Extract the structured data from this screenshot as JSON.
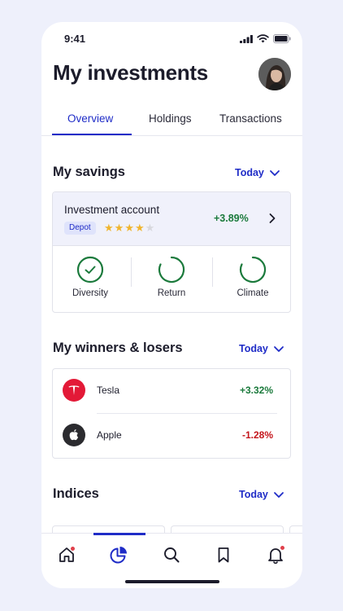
{
  "status_bar": {
    "time": "9:41"
  },
  "header": {
    "title": "My investments"
  },
  "tabs": [
    {
      "label": "Overview",
      "active": true
    },
    {
      "label": "Holdings",
      "active": false
    },
    {
      "label": "Transactions",
      "active": false
    }
  ],
  "savings": {
    "title": "My savings",
    "period": "Today",
    "account": {
      "name": "Investment account",
      "badge": "Depot",
      "rating": 4,
      "rating_max": 5,
      "change": "+3.89%"
    },
    "metrics": [
      {
        "label": "Diversity",
        "state": "check"
      },
      {
        "label": "Return",
        "state": "ring"
      },
      {
        "label": "Climate",
        "state": "ring"
      }
    ]
  },
  "winners_losers": {
    "title": "My winners & losers",
    "period": "Today",
    "items": [
      {
        "name": "Tesla",
        "change": "+3.32%",
        "direction": "up",
        "icon": "tesla-logo-icon"
      },
      {
        "name": "Apple",
        "change": "-1.28%",
        "direction": "down",
        "icon": "apple-logo-icon"
      }
    ]
  },
  "indices": {
    "title": "Indices",
    "period": "Today"
  },
  "bottom_nav": [
    {
      "icon": "home-icon",
      "active": false,
      "notification": true
    },
    {
      "icon": "portfolio-pie-icon",
      "active": true,
      "notification": false
    },
    {
      "icon": "search-icon",
      "active": false,
      "notification": false
    },
    {
      "icon": "bookmark-icon",
      "active": false,
      "notification": false
    },
    {
      "icon": "bell-icon",
      "active": false,
      "notification": true
    }
  ],
  "colors": {
    "accent": "#1f2cc7",
    "positive": "#1b7a3c",
    "negative": "#c4161c",
    "card_highlight": "#f0f1fb",
    "star": "#f0b52e"
  }
}
